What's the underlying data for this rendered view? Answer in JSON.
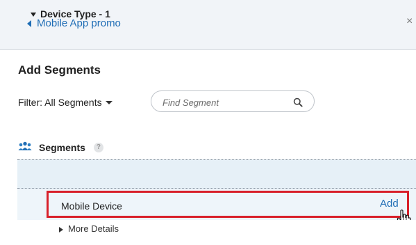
{
  "header": {
    "back_label": "Mobile App promo",
    "close_glyph": "×"
  },
  "panel": {
    "title": "Add Segments",
    "filter_label": "Filter: All Segments",
    "search": {
      "placeholder": "Find Segment",
      "value": ""
    }
  },
  "segments": {
    "heading": "Segments",
    "help_glyph": "?",
    "group": {
      "label": "Device Type - 1"
    },
    "item": {
      "label": "Mobile Device",
      "action": "Add"
    },
    "details_label": "More Details"
  },
  "icons": [
    "back-arrow-icon",
    "close-icon",
    "search-icon",
    "people-icon",
    "help-icon",
    "caret-down-icon",
    "hand-cursor-icon"
  ],
  "colors": {
    "link": "#1f6db5",
    "highlight": "#d8202a",
    "row_bg": "#e6f0f7",
    "header_bg": "#f1f4f8"
  }
}
